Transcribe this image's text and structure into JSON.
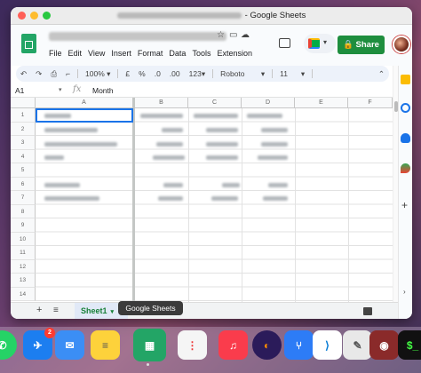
{
  "window": {
    "title_suffix": "- Google Sheets"
  },
  "menu": [
    "File",
    "Edit",
    "View",
    "Insert",
    "Format",
    "Data",
    "Tools",
    "Extension"
  ],
  "header": {
    "share_label": "Share"
  },
  "toolbar": {
    "zoom": "100%",
    "currency": "£",
    "percent": "%",
    "dec_decrease": ".0",
    "dec_increase": ".00",
    "number_format": "123",
    "font": "Roboto",
    "font_size": "11"
  },
  "formula_bar": {
    "cell_ref": "A1",
    "fx": "fx",
    "value": "Month"
  },
  "columns": [
    "A",
    "B",
    "C",
    "D",
    "E",
    "F"
  ],
  "rows": [
    "1",
    "2",
    "3",
    "4",
    "5",
    "6",
    "7",
    "8",
    "9",
    "10",
    "11",
    "12",
    "13",
    "14"
  ],
  "sheet_tab": {
    "label": "Sheet1"
  },
  "tooltip": "Google Sheets",
  "dock": {
    "mail_badge": "2"
  },
  "colors": {
    "share_green": "#1e8e3e",
    "selection_blue": "#1a73e8",
    "tab_green": "#188038"
  }
}
